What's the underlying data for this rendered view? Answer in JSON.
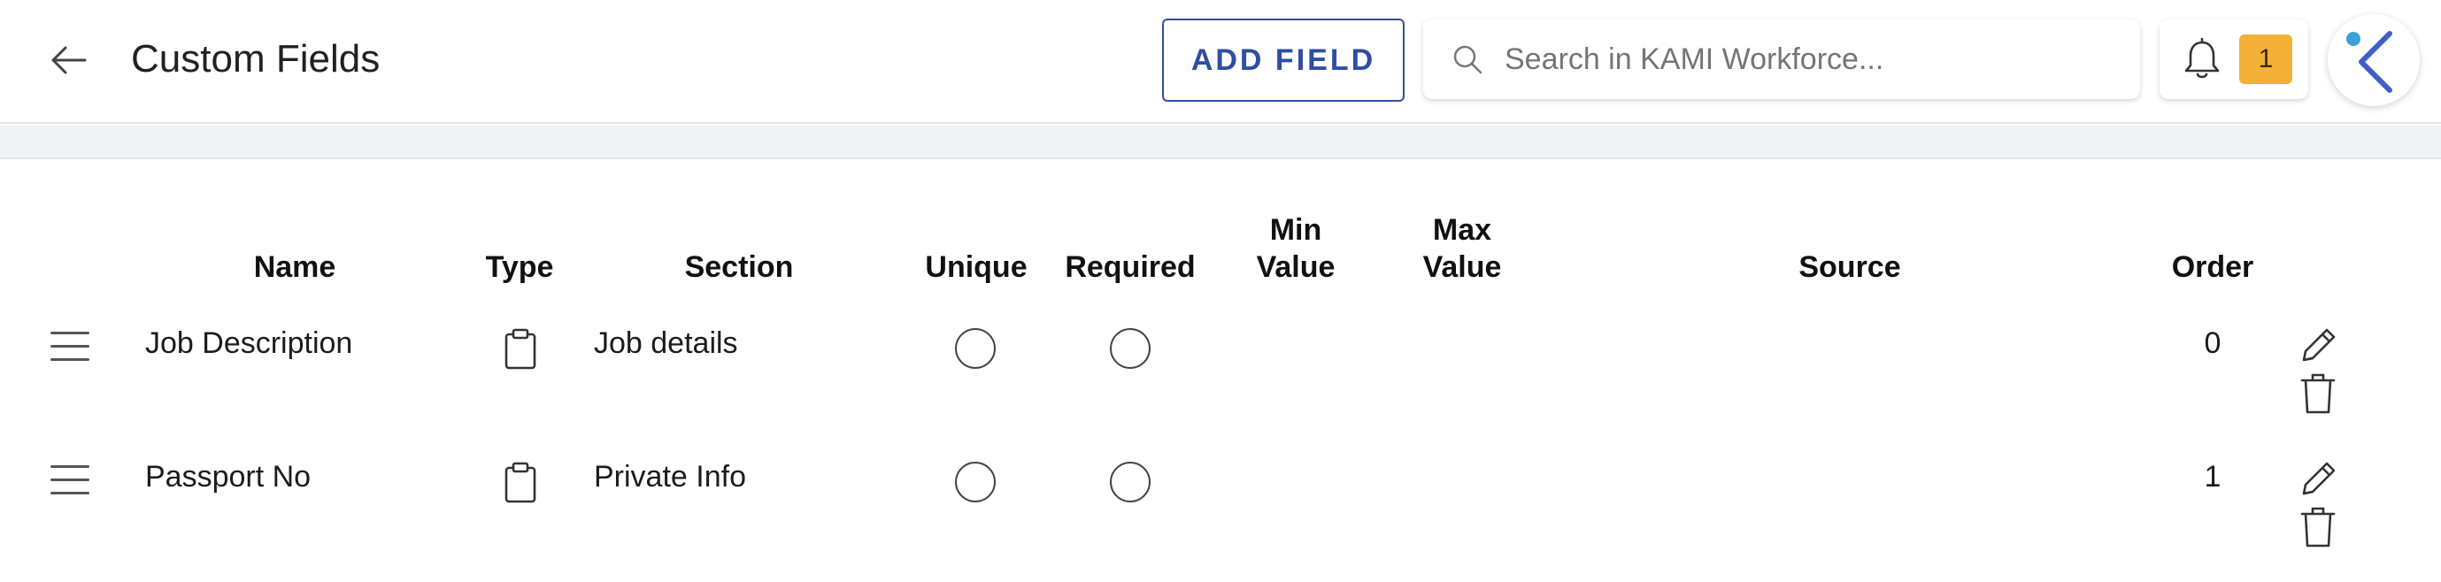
{
  "header": {
    "title": "Custom Fields",
    "add_field_label": "ADD FIELD",
    "search_placeholder": "Search in KAMI Workforce...",
    "notification_count": "1"
  },
  "table": {
    "columns": {
      "name": "Name",
      "type": "Type",
      "section": "Section",
      "unique": "Unique",
      "required": "Required",
      "min_value_line1": "Min",
      "min_value_line2": "Value",
      "max_value_line1": "Max",
      "max_value_line2": "Value",
      "source": "Source",
      "order": "Order"
    },
    "rows": [
      {
        "name": "Job Description",
        "type_icon": "clipboard-icon",
        "section": "Job details",
        "unique": false,
        "required": false,
        "min_value": "",
        "max_value": "",
        "source": "",
        "order": "0"
      },
      {
        "name": "Passport No",
        "type_icon": "clipboard-icon",
        "section": "Private Info",
        "unique": false,
        "required": false,
        "min_value": "",
        "max_value": "",
        "source": "",
        "order": "1"
      }
    ]
  },
  "colors": {
    "accent": "#2f4ea3",
    "badge": "#f3b13a",
    "logo_dot": "#3b9fd8",
    "logo_stroke": "#3f5fc4"
  }
}
